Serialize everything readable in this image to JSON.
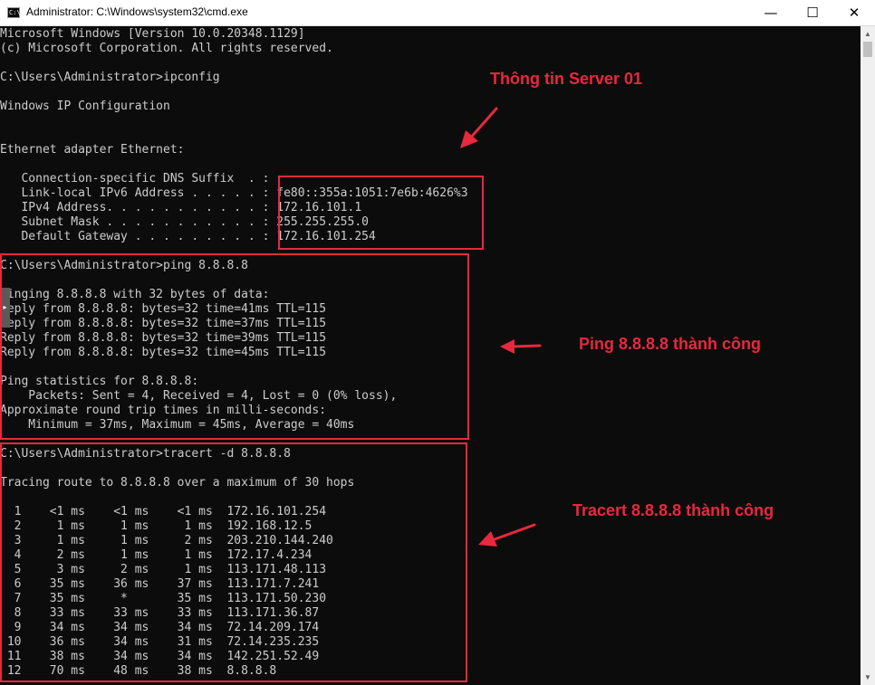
{
  "window": {
    "title": "Administrator: C:\\Windows\\system32\\cmd.exe",
    "icon": "cmd-icon",
    "controls": {
      "minimize": "—",
      "maximize": "☐",
      "close": "✕"
    }
  },
  "console": {
    "lines": [
      "Microsoft Windows [Version 10.0.20348.1129]",
      "(c) Microsoft Corporation. All rights reserved.",
      "",
      "C:\\Users\\Administrator>ipconfig",
      "",
      "Windows IP Configuration",
      "",
      "",
      "Ethernet adapter Ethernet:",
      "",
      "   Connection-specific DNS Suffix  . :",
      "   Link-local IPv6 Address . . . . . : fe80::355a:1051:7e6b:4626%3",
      "   IPv4 Address. . . . . . . . . . . : 172.16.101.1",
      "   Subnet Mask . . . . . . . . . . . : 255.255.255.0",
      "   Default Gateway . . . . . . . . . : 172.16.101.254",
      "",
      "C:\\Users\\Administrator>ping 8.8.8.8",
      "",
      "Pinging 8.8.8.8 with 32 bytes of data:",
      "Reply from 8.8.8.8: bytes=32 time=41ms TTL=115",
      "Reply from 8.8.8.8: bytes=32 time=37ms TTL=115",
      "Reply from 8.8.8.8: bytes=32 time=39ms TTL=115",
      "Reply from 8.8.8.8: bytes=32 time=45ms TTL=115",
      "",
      "Ping statistics for 8.8.8.8:",
      "    Packets: Sent = 4, Received = 4, Lost = 0 (0% loss),",
      "Approximate round trip times in milli-seconds:",
      "    Minimum = 37ms, Maximum = 45ms, Average = 40ms",
      "",
      "C:\\Users\\Administrator>tracert -d 8.8.8.8",
      "",
      "Tracing route to 8.8.8.8 over a maximum of 30 hops",
      "",
      "  1    <1 ms    <1 ms    <1 ms  172.16.101.254",
      "  2     1 ms     1 ms     1 ms  192.168.12.5",
      "  3     1 ms     1 ms     2 ms  203.210.144.240",
      "  4     2 ms     1 ms     1 ms  172.17.4.234",
      "  5     3 ms     2 ms     1 ms  113.171.48.113",
      "  6    35 ms    36 ms    37 ms  113.171.7.241",
      "  7    35 ms     *       35 ms  113.171.50.230",
      "  8    33 ms    33 ms    33 ms  113.171.36.87",
      "  9    34 ms    34 ms    34 ms  72.14.209.174",
      " 10    36 ms    34 ms    31 ms  72.14.235.235",
      " 11    38 ms    34 ms    34 ms  142.251.52.49",
      " 12    70 ms    48 ms    38 ms  8.8.8.8"
    ]
  },
  "annotations": {
    "server_info": "Thông tin Server 01",
    "ping_success": "Ping 8.8.8.8 thành công",
    "tracert_success": "Tracert 8.8.8.8 thành công",
    "color": "#e8283d"
  },
  "scrollbar": {
    "up": "▲",
    "down": "▼"
  },
  "side_tab": {
    "glyph": "▸"
  }
}
